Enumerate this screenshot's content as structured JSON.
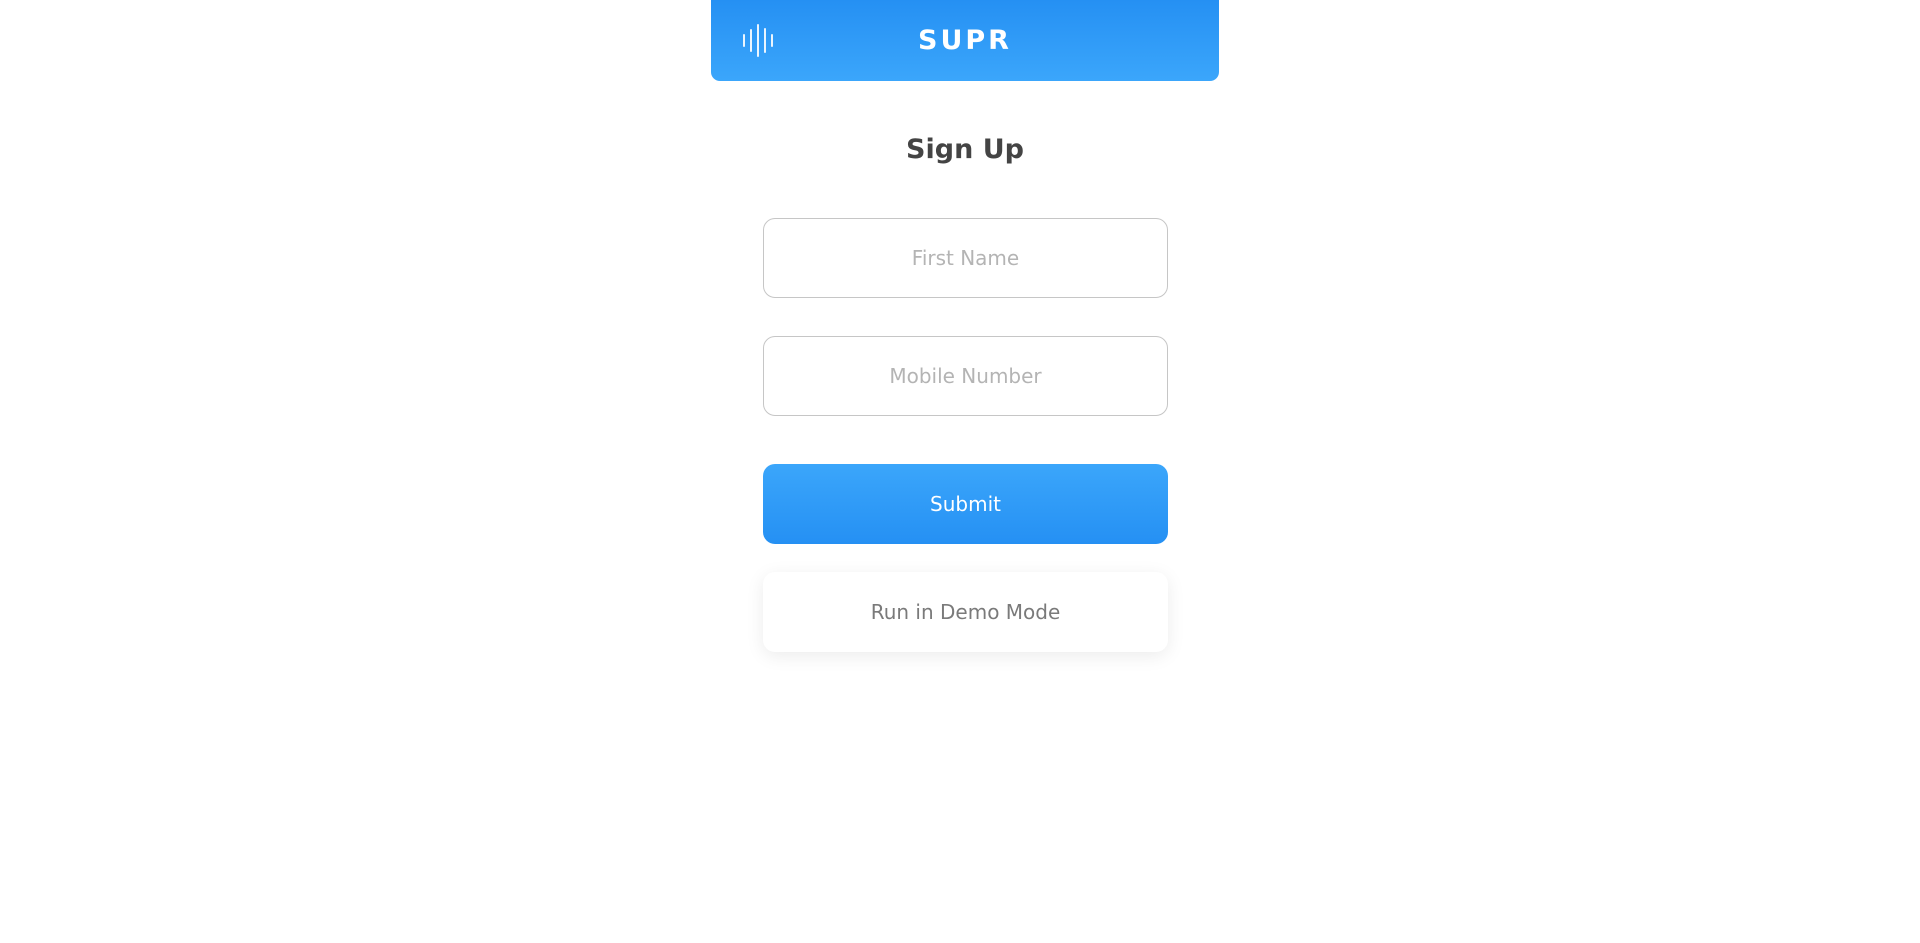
{
  "header": {
    "brand": "SUPR",
    "logo_icon": "sound-wave-icon",
    "accent_color": "#2590f3"
  },
  "form": {
    "title": "Sign Up",
    "first_name_placeholder": "First Name",
    "first_name_value": "",
    "mobile_placeholder": "Mobile Number",
    "mobile_value": "",
    "submit_label": "Submit",
    "demo_label": "Run in Demo Mode"
  }
}
